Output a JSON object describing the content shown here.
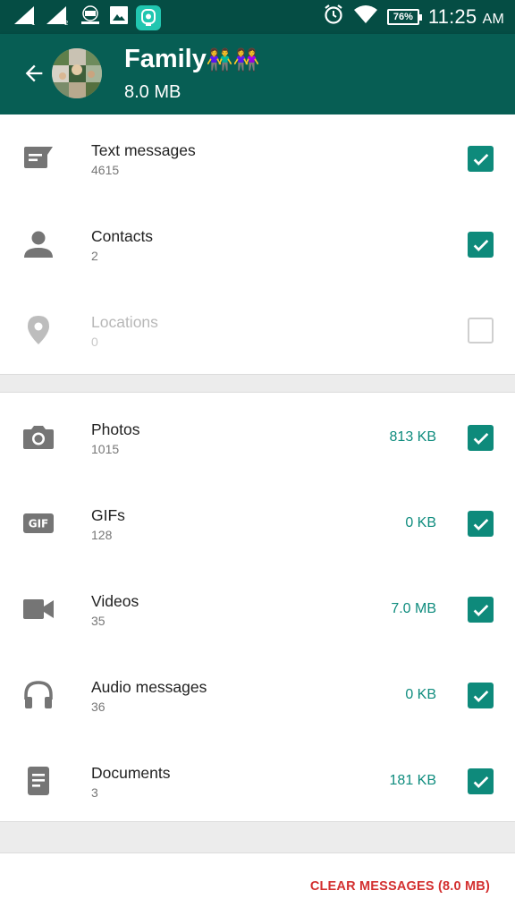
{
  "status_bar": {
    "time": "11:25",
    "ampm": "AM",
    "battery": "76%",
    "icons": [
      "signal-1-icon",
      "signal-2-icon",
      "app-logo-icon",
      "image-icon",
      "camera-app-icon",
      "alarm-icon",
      "wifi-icon",
      "battery-icon"
    ]
  },
  "header": {
    "title": "Family",
    "title_emoji": "👫👭",
    "subtitle": "8.0 MB"
  },
  "items_group1": [
    {
      "label": "Text messages",
      "count": "4615",
      "checked": true,
      "icon": "message-icon"
    },
    {
      "label": "Contacts",
      "count": "2",
      "checked": true,
      "icon": "person-icon"
    },
    {
      "label": "Locations",
      "count": "0",
      "checked": false,
      "disabled": true,
      "icon": "location-pin-icon"
    }
  ],
  "items_group2": [
    {
      "label": "Photos",
      "count": "1015",
      "size": "813 KB",
      "checked": true,
      "icon": "camera-icon"
    },
    {
      "label": "GIFs",
      "count": "128",
      "size": "0 KB",
      "checked": true,
      "icon": "gif-icon"
    },
    {
      "label": "Videos",
      "count": "35",
      "size": "7.0 MB",
      "checked": true,
      "icon": "video-icon"
    },
    {
      "label": "Audio messages",
      "count": "36",
      "size": "0 KB",
      "checked": true,
      "icon": "headphones-icon"
    },
    {
      "label": "Documents",
      "count": "3",
      "size": "181 KB",
      "checked": true,
      "icon": "document-icon"
    }
  ],
  "footer": {
    "clear_label": "CLEAR MESSAGES (8.0 MB)"
  },
  "colors": {
    "status_bar": "#054d44",
    "app_bar": "#075e54",
    "accent": "#0e8a7b",
    "danger": "#d32f2f"
  }
}
